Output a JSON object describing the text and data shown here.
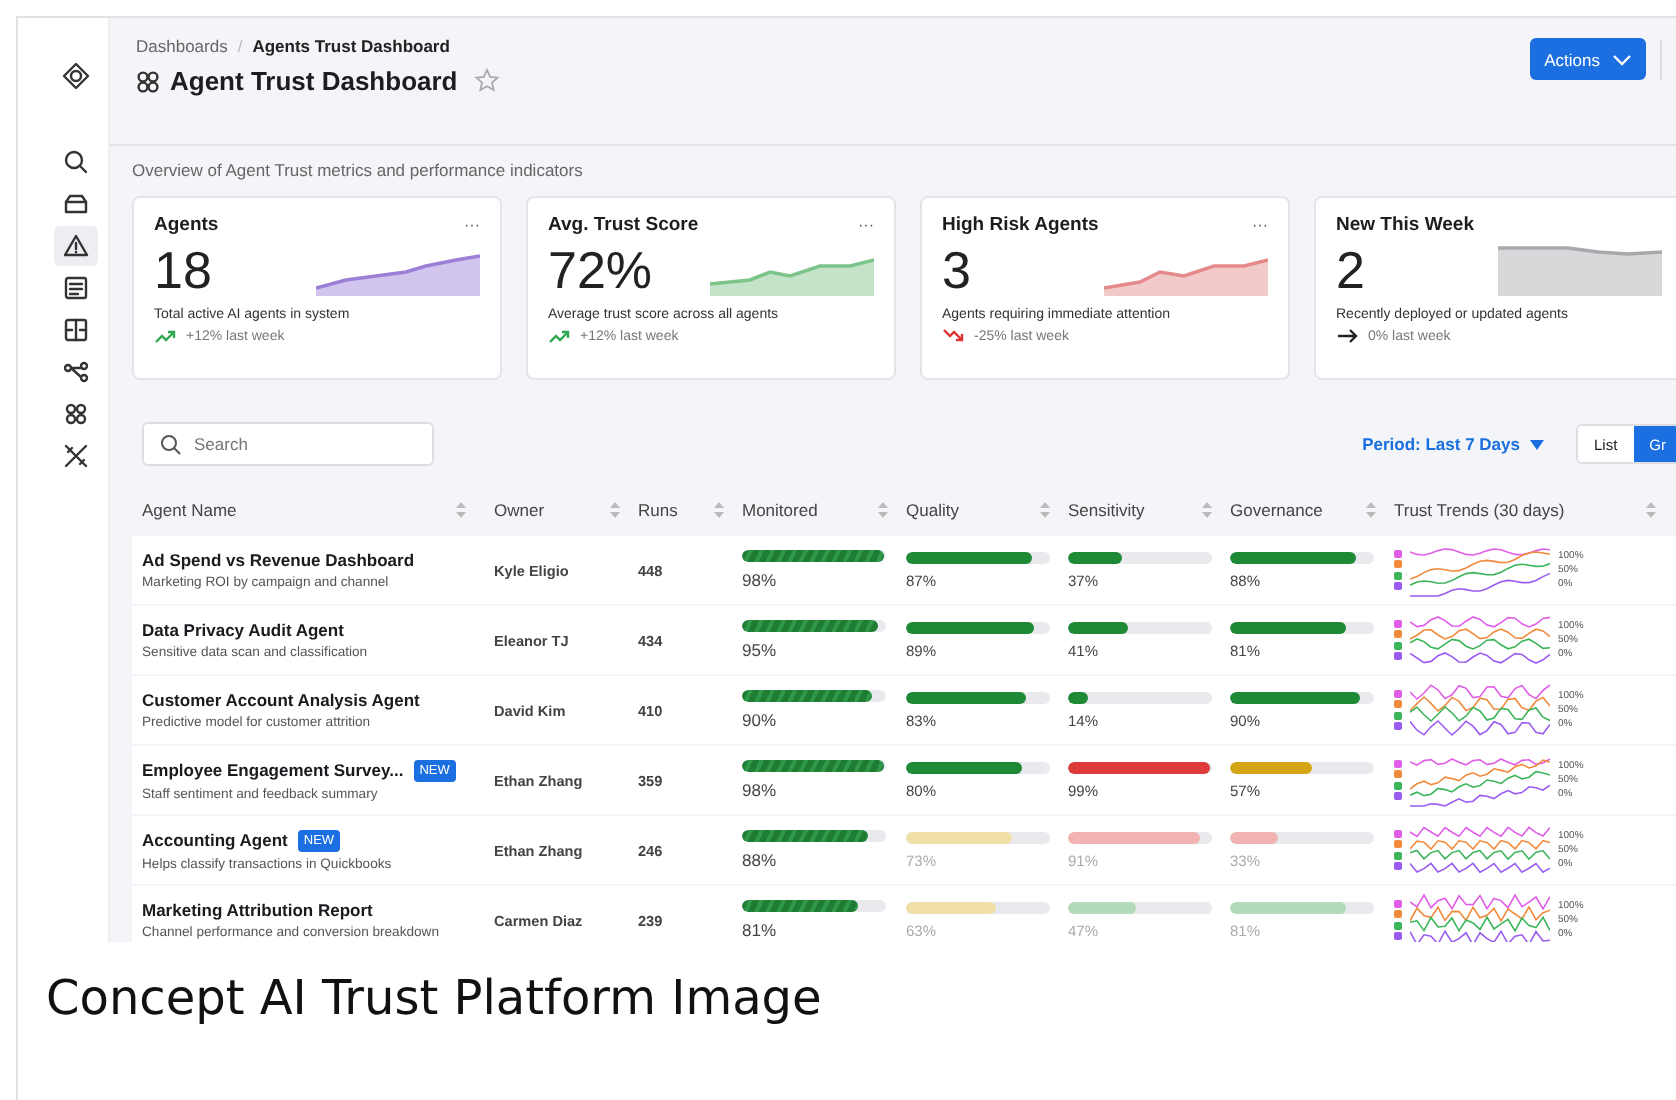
{
  "sidebar": {
    "items": [
      {
        "kind": "search",
        "selected": false
      },
      {
        "kind": "inbox",
        "selected": false
      },
      {
        "kind": "warning",
        "selected": true
      },
      {
        "kind": "document",
        "selected": false
      },
      {
        "kind": "layout",
        "selected": false
      },
      {
        "kind": "flow",
        "selected": false
      },
      {
        "kind": "grid",
        "selected": false
      },
      {
        "kind": "tools",
        "selected": false
      }
    ]
  },
  "breadcrumb": [
    "Dashboards",
    "Agents Trust Dashboard"
  ],
  "breadcrumb_separator": "/",
  "title": "Agent Trust Dashboard",
  "favorite": false,
  "actions_button": "Actions",
  "subtitle": "Overview of Agent Trust metrics and performance indicators",
  "cards": [
    {
      "title": "Agents",
      "menu": "···",
      "value": "18",
      "description": "Total active AI agents in system",
      "kind": "up",
      "change": "+12% last week",
      "color": "#9b7fd6"
    },
    {
      "title": "Avg. Trust Score",
      "menu": "···",
      "value": "72%",
      "description": "Average trust score across all agents",
      "kind": "up",
      "change": "+12% last week",
      "color": "#7cc48a"
    },
    {
      "title": "High Risk Agents",
      "menu": "···",
      "value": "3",
      "description": "Agents requiring immediate attention",
      "kind": "down",
      "change": "-25% last week",
      "color": "#e58a8a"
    },
    {
      "title": "New This Week",
      "value": "2",
      "description": "Recently deployed or updated agents",
      "kind": "flat",
      "change": "0% last week",
      "color": "#a9a9ad"
    }
  ],
  "search": {
    "placeholder": "Search"
  },
  "period": "Period: Last 7  Days",
  "view_toggle": [
    {
      "label": "List",
      "selected": false
    },
    {
      "label": "Gr",
      "selected": true
    }
  ],
  "table": {
    "columns": [
      "Agent Name",
      "Owner",
      "Runs",
      "Monitored",
      "Quality",
      "Sensitivity",
      "Governance",
      "Trust Trends (30 days)"
    ],
    "rows": [
      {
        "name": "Ad Spend vs Revenue Dashboard",
        "description": "Marketing ROI by campaign and channel",
        "owner": "Kyle Eligio",
        "runs": "448",
        "dimmed": false,
        "monitored": {
          "level": 0.98,
          "text": "98%"
        },
        "quality": {
          "level": 0.87,
          "color": "#1f8a36",
          "text": "87%"
        },
        "sensitivity": {
          "level": 0.37,
          "color": "#1f8a36",
          "text": "37%"
        },
        "governance": {
          "level": 0.88,
          "color": "#1f8a36",
          "text": "88%"
        },
        "trend_labels": [
          "100%",
          "50%",
          "0%"
        ]
      },
      {
        "name": "Data Privacy Audit Agent",
        "description": "Sensitive data scan and classification",
        "owner": "Eleanor  TJ",
        "runs": "434",
        "dimmed": false,
        "monitored": {
          "level": 0.95,
          "text": "95%"
        },
        "quality": {
          "level": 0.89,
          "color": "#1f8a36",
          "text": "89%"
        },
        "sensitivity": {
          "level": 0.41,
          "color": "#1f8a36",
          "text": "41%"
        },
        "governance": {
          "level": 0.81,
          "color": "#1f8a36",
          "text": "81%"
        },
        "trend_labels": [
          "100%",
          "50%",
          "0%"
        ]
      },
      {
        "name": "Customer Account Analysis Agent",
        "description": "Predictive model for customer attrition",
        "owner": "David Kim",
        "runs": "410",
        "dimmed": false,
        "monitored": {
          "level": 0.9,
          "text": "90%"
        },
        "quality": {
          "level": 0.83,
          "color": "#1f8a36",
          "text": "83%"
        },
        "sensitivity": {
          "level": 0.14,
          "color": "#1f8a36",
          "text": "14%"
        },
        "governance": {
          "level": 0.9,
          "color": "#1f8a36",
          "text": "90%"
        },
        "trend_labels": [
          "100%",
          "50%",
          "0%"
        ]
      },
      {
        "name": "Employee Engagement Survey...",
        "badge": "NEW",
        "description": "Staff sentiment and feedback summary",
        "owner": "Ethan Zhang",
        "runs": "359",
        "dimmed": false,
        "monitored": {
          "level": 0.98,
          "text": "98%"
        },
        "quality": {
          "level": 0.8,
          "color": "#1f8a36",
          "text": "80%"
        },
        "sensitivity": {
          "level": 0.99,
          "color": "#dd3b3b",
          "text": "99%"
        },
        "governance": {
          "level": 0.57,
          "color": "#d6a417",
          "text": "57%"
        },
        "trend_labels": [
          "100%",
          "50%",
          "0%"
        ]
      },
      {
        "name": "Accounting Agent",
        "badge": "NEW",
        "description": "Helps classify transactions in Quickbooks",
        "owner": "Ethan Zhang",
        "runs": "246",
        "dimmed": true,
        "monitored": {
          "level": 0.88,
          "text": "88%"
        },
        "quality": {
          "level": 0.73,
          "color": "#f0dfa6",
          "text": "73%"
        },
        "sensitivity": {
          "level": 0.91,
          "color": "#f2b3b3",
          "text": "91%"
        },
        "governance": {
          "level": 0.33,
          "color": "#f2b3b3",
          "text": "33%"
        },
        "trend_labels": [
          "100%",
          "50%",
          "0%"
        ]
      },
      {
        "name": "Marketing Attribution Report",
        "description": "Channel performance and conversion breakdown",
        "owner": "Carmen Diaz",
        "runs": "239",
        "dimmed": true,
        "monitored": {
          "level": 0.81,
          "text": "81%"
        },
        "quality": {
          "level": 0.63,
          "color": "#f0dfa6",
          "text": "63%"
        },
        "sensitivity": {
          "level": 0.47,
          "color": "#b3dbbb",
          "text": "47%"
        },
        "governance": {
          "level": 0.81,
          "color": "#b3dbbb",
          "text": "81%"
        },
        "trend_labels": [
          "100%",
          "50%",
          "0%"
        ]
      }
    ]
  },
  "trend_legend": [
    {
      "color": "#e05ee8"
    },
    {
      "color": "#f28a3c"
    },
    {
      "color": "#3cb55a"
    },
    {
      "color": "#9a5cf0"
    }
  ],
  "caption": "Concept AI Trust Platform Image"
}
